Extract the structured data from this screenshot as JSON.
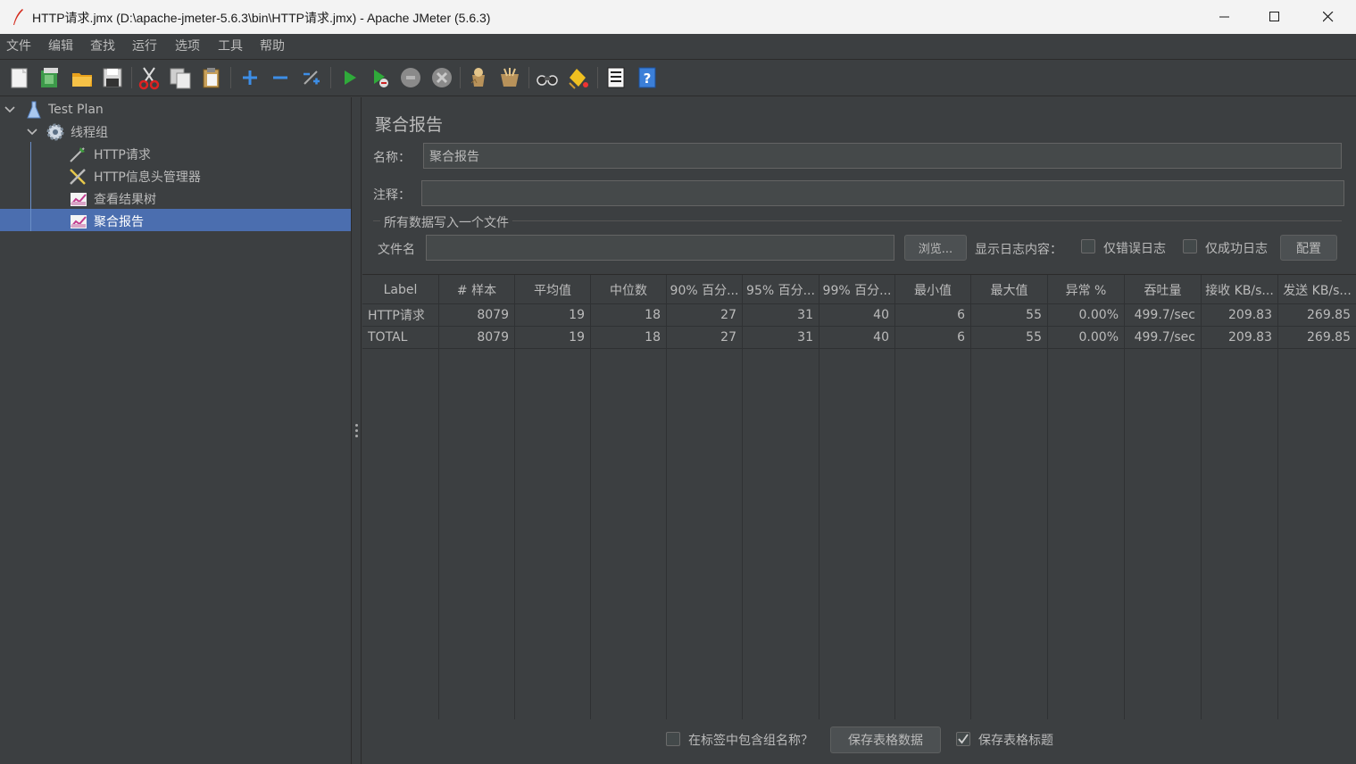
{
  "window": {
    "title": "HTTP请求.jmx (D:\\apache-jmeter-5.6.3\\bin\\HTTP请求.jmx) - Apache JMeter (5.6.3)"
  },
  "menu": [
    "文件",
    "编辑",
    "查找",
    "运行",
    "选项",
    "工具",
    "帮助"
  ],
  "toolbar": {
    "icons": [
      "new-icon",
      "templates-icon",
      "open-icon",
      "save-icon",
      "cut-icon",
      "copy-icon",
      "paste-icon",
      "expand-icon",
      "collapse-icon",
      "toggle-icon",
      "start-icon",
      "start-no-pause-icon",
      "stop-icon",
      "shutdown-icon",
      "clear-icon",
      "clear-all-icon",
      "search-icon",
      "reset-search-icon",
      "function-helper-icon",
      "help-icon"
    ]
  },
  "tree": {
    "items": [
      {
        "label": "Test Plan",
        "icon": "test-plan-icon"
      },
      {
        "label": "线程组",
        "icon": "gear-icon"
      },
      {
        "label": "HTTP请求",
        "icon": "sampler-icon"
      },
      {
        "label": "HTTP信息头管理器",
        "icon": "config-icon"
      },
      {
        "label": "查看结果树",
        "icon": "listener-icon"
      },
      {
        "label": "聚合报告",
        "icon": "listener-icon"
      }
    ]
  },
  "panel": {
    "title": "聚合报告",
    "name_label": "名称：",
    "name_value": "聚合报告",
    "comment_label": "注释：",
    "comment_value": "",
    "group_title": "所有数据写入一个文件",
    "filename_label": "文件名",
    "filename_value": "",
    "browse_label": "浏览...",
    "log_label": "显示日志内容：",
    "errors_only_label": "仅错误日志",
    "success_only_label": "仅成功日志",
    "configure_label": "配置"
  },
  "table": {
    "headers": [
      "Label",
      "# 样本",
      "平均值",
      "中位数",
      "90% 百分...",
      "95% 百分...",
      "99% 百分...",
      "最小值",
      "最大值",
      "异常 %",
      "吞吐量",
      "接收 KB/s...",
      "发送 KB/s..."
    ],
    "rows": [
      [
        "HTTP请求",
        "8079",
        "19",
        "18",
        "27",
        "31",
        "40",
        "6",
        "55",
        "0.00%",
        "499.7/sec",
        "209.83",
        "269.85"
      ],
      [
        "TOTAL",
        "8079",
        "19",
        "18",
        "27",
        "31",
        "40",
        "6",
        "55",
        "0.00%",
        "499.7/sec",
        "209.83",
        "269.85"
      ]
    ]
  },
  "bottom": {
    "include_group_label": "在标签中包含组名称？",
    "include_group_checked": false,
    "save_table_label": "保存表格数据",
    "save_header_label": "保存表格标题",
    "save_header_checked": true
  },
  "colors": {
    "background": "#3c3f41",
    "selection": "#4b6eaf",
    "text": "#bbbbbb"
  }
}
